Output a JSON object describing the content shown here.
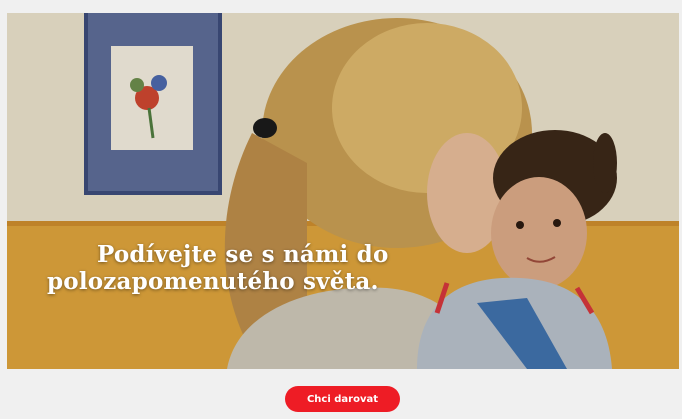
{
  "hero": {
    "headline_line1": "Podívejte se s námi do",
    "headline_line2": "polozapomenutého světa."
  },
  "cta": {
    "donate_label": "Chci darovat"
  },
  "colors": {
    "accent": "#ee1c25",
    "page_background": "#f0f0f0",
    "wall_upper": "#e3dcc8",
    "wall_lower": "#d9a23c"
  }
}
